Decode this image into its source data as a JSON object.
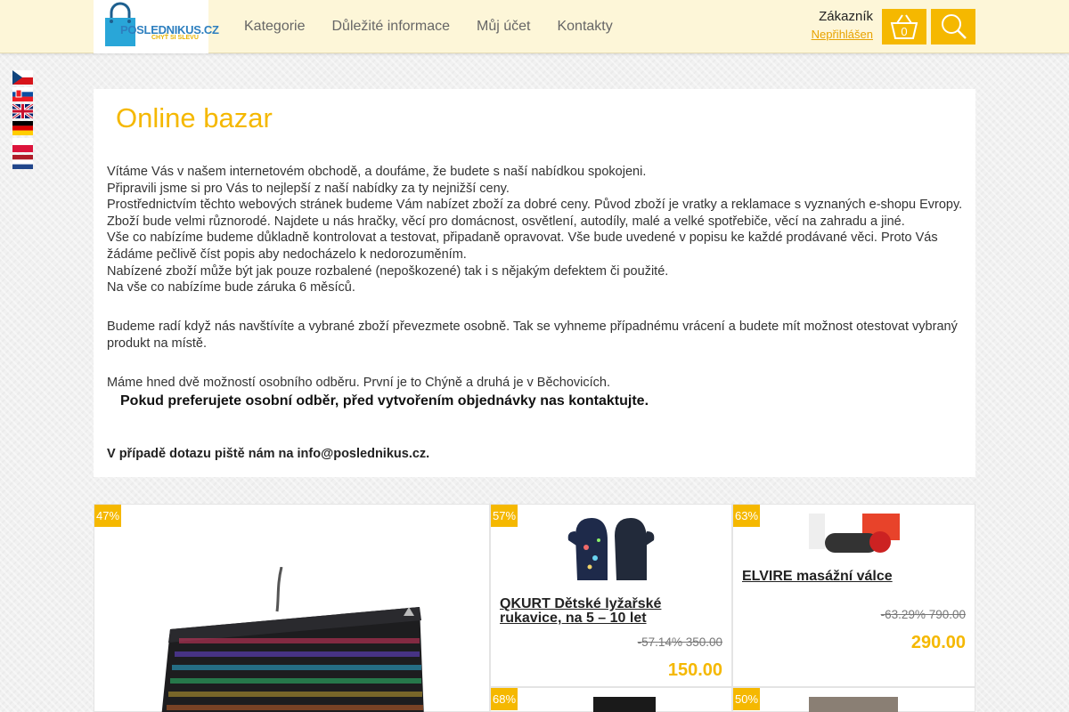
{
  "header": {
    "logo_text": "POSLEDNIKUS.CZ",
    "logo_sub": "CHYŤ SI SLEVU",
    "nav": [
      "Kategorie",
      "Důležité informace",
      "Můj účet",
      "Kontakty"
    ],
    "customer_title": "Zákazník",
    "customer_status": "Nepřihlášen",
    "cart_count": "0"
  },
  "flags": [
    "cz",
    "sk",
    "gb",
    "de",
    "pl",
    "nl"
  ],
  "info": {
    "title": "Online bazar",
    "paragraphs_1": [
      "Vítáme Vás v našem internetovém obchodě, a doufáme, že budete s naší nabídkou spokojeni.",
      "Připravili jsme si pro Vás to nejlepší z naší nabídky za ty nejnižší ceny.",
      "Prostřednictvím těchto webových stránek budeme Vám nabízet zboží za dobré ceny. Původ zboží je vratky a reklamace s vyznaných e-shopu Evropy.",
      "Zboží bude velmi různorodé. Najdete u nás hračky, věcí pro domácnost, osvětlení, autodíly, malé a velké spotřebiče, věcí na zahradu a jiné.",
      "Vše co nabízíme budeme důkladně kontrolovat a testovat, připadaně opravovat. Vše bude uvedené v popisu ke každé prodávané věci. Proto Vás žádáme pečlivě číst popis aby nedocházelo k nedorozuměním.",
      "Nabízené zboží může být jak pouze rozbalené (nepoškozené) tak i s nějakým defektem či použité.",
      "Na vše co nabízíme bude záruka 6 měsíců."
    ],
    "paragraph_2": "Budeme radí když nás navštívíte a vybrané zboží převezmete osobně. Tak se vyhneme případnému vrácení a budete mít možnost otestovat vybraný produkt na místě.",
    "paragraph_3": "Máme hned dvě možností osobního odběru. První je to Chýně a druhá je v Běchovicích.",
    "pickup_note": "Pokud preferujete osobní odběr, před vytvořením objednávky nas kontaktujte.",
    "contact_note": "V případě dotazu piště nám na info@poslednikus.cz."
  },
  "products": [
    {
      "badge": "47%",
      "title": "",
      "old": "",
      "price": ""
    },
    {
      "badge": "57%",
      "title": "QKURT Dětské lyžařské rukavice, na 5 – 10 let",
      "old": "-57.14% 350.00",
      "price": "150.00"
    },
    {
      "badge": "63%",
      "title": "ELVIRE masážní válce",
      "old": "-63.29% 790.00",
      "price": "290.00"
    },
    {
      "badge": "68%",
      "title": "",
      "old": "",
      "price": ""
    },
    {
      "badge": "50%",
      "title": "",
      "old": "",
      "price": ""
    }
  ],
  "colors": {
    "accent": "#f5b800",
    "header_bg": "#fdf6d8"
  }
}
